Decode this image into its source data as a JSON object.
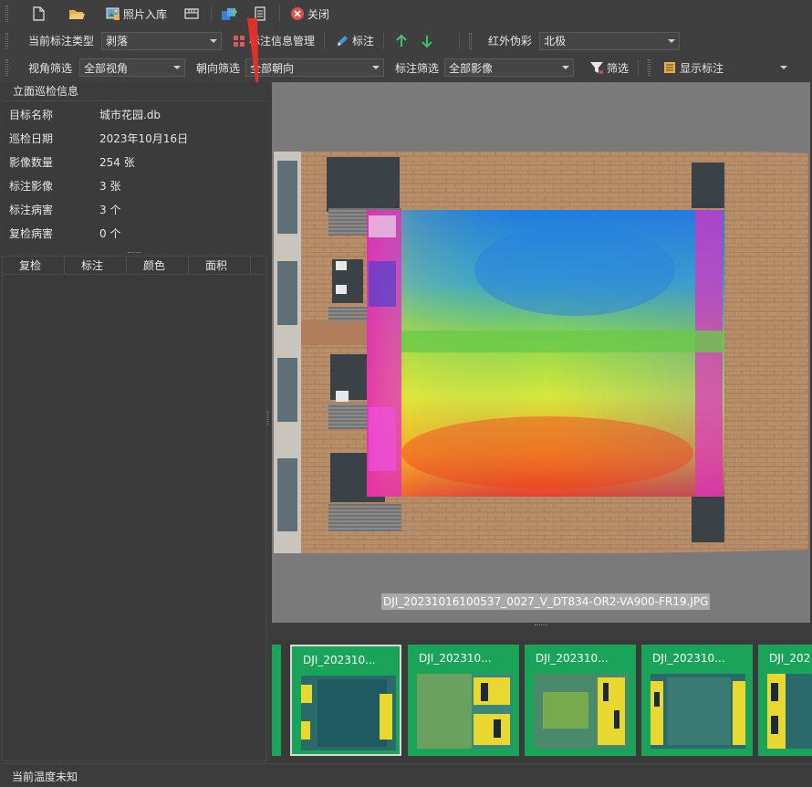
{
  "toolbar1": {
    "import_label": "照片入库",
    "close_label": "关闭"
  },
  "toolbar2": {
    "current_type_label": "当前标注类型",
    "current_type_value": "剥落",
    "manage_label": "标注信息管理",
    "annotate_label": "标注",
    "pseudo_label": "红外伪彩",
    "pseudo_value": "北极"
  },
  "toolbar3": {
    "view_filter_label": "视角筛选",
    "view_filter_value": "全部视角",
    "orient_filter_label": "朝向筛选",
    "orient_filter_value": "全部朝向",
    "mark_filter_label": "标注筛选",
    "mark_filter_value": "全部影像",
    "filter_label": "筛选",
    "show_label": "显示标注"
  },
  "info": {
    "title": "立面巡检信息",
    "rows": [
      {
        "key": "目标名称",
        "value": "城市花园.db"
      },
      {
        "key": "巡检日期",
        "value": "2023年10月16日"
      },
      {
        "key": "影像数量",
        "value": "254 张"
      },
      {
        "key": "标注影像",
        "value": "3 张"
      },
      {
        "key": "标注病害",
        "value": "3 个"
      },
      {
        "key": "复检病害",
        "value": "0 个"
      }
    ]
  },
  "table": {
    "columns": [
      "复检",
      "标注",
      "颜色",
      "面积"
    ]
  },
  "viewer": {
    "filename": "DJI_20231016100537_0027_V_DT834-OR2-VA900-FR19.JPG"
  },
  "thumbnails": [
    {
      "name": "DJI_202310..."
    },
    {
      "name": "DJI_202310..."
    },
    {
      "name": "DJI_202310..."
    },
    {
      "name": "DJI_202310..."
    },
    {
      "name": "DJI_202"
    }
  ],
  "status": {
    "text": "当前温度未知"
  },
  "colors": {
    "accent_green": "#1aa45a",
    "arrow_green": "#3cc46a",
    "close_red": "#d9534f",
    "annotation_arrow": "#e8302a"
  }
}
